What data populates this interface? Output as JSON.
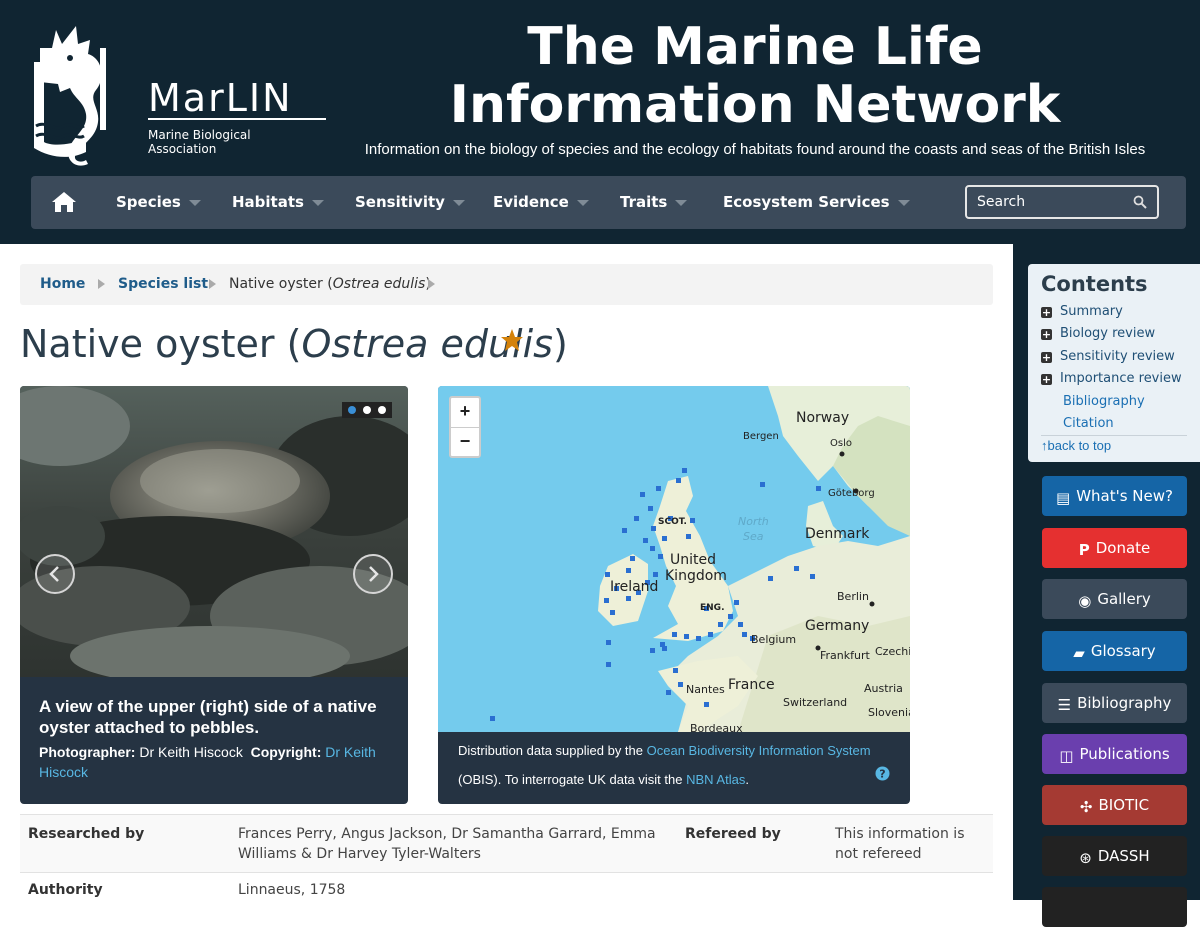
{
  "header": {
    "logo_text": "MarLIN",
    "logo_subtitle": "Marine Biological Association",
    "site_title": "The Marine Life Information Network",
    "tagline": "Information on the biology of species and the ecology of habitats found around the coasts and seas of the British Isles"
  },
  "nav": {
    "home_icon": "home-icon",
    "items": [
      {
        "label": "Species"
      },
      {
        "label": "Habitats"
      },
      {
        "label": "Sensitivity"
      },
      {
        "label": "Evidence"
      },
      {
        "label": "Traits"
      },
      {
        "label": "Ecosystem Services"
      }
    ],
    "search_placeholder": "Search"
  },
  "breadcrumb": {
    "home": "Home",
    "species_list": "Species list",
    "current_common": "Native oyster (",
    "current_sci": "Ostrea edulis",
    "current_end": ")"
  },
  "page": {
    "title_common": "Native oyster (",
    "title_sci": "Ostrea edulis",
    "title_end": ")",
    "favourite_icon": "star-icon"
  },
  "photo": {
    "caption": "A view of the upper (right) side of a native oyster attached to pebbles.",
    "photographer_label": "Photographer:",
    "photographer": "Dr Keith Hiscock",
    "copyright_label": "Copyright:",
    "copyright": "Dr Keith Hiscock",
    "slide_count": 3,
    "active_slide": 1
  },
  "map": {
    "zoom_in": "+",
    "zoom_out": "−",
    "labels": {
      "norway": "Norway",
      "bergen": "Bergen",
      "oslo": "Oslo",
      "goteborg": "Göteborg",
      "north_sea_1": "North",
      "north_sea_2": "Sea",
      "denmark": "Denmark",
      "scot": "SCOT.",
      "united": "United",
      "kingdom": "Kingdom",
      "ireland": "Ireland",
      "eng": "ENG.",
      "berlin": "Berlin",
      "germany": "Germany",
      "belgium": "Belgium",
      "frankfurt": "Frankfurt",
      "czechia": "Czechia",
      "france": "France",
      "nantes": "Nantes",
      "austria": "Austria",
      "switzerland": "Switzerland",
      "slovenia": "Slovenia",
      "bordeaux": "Bordeaux"
    },
    "note_prefix": "Distribution data supplied by the ",
    "note_link1": "Ocean Biodiversity Information System",
    "note_middle": " (OBIS). To interrogate UK data visit the ",
    "note_link2": "NBN Atlas",
    "note_end": ".",
    "help_icon": "help-icon"
  },
  "meta": {
    "researched_label": "Researched by",
    "researched_value": "Frances Perry, Angus Jackson, Dr Samantha Garrard, Emma Williams & Dr Harvey Tyler-Walters",
    "refereed_label": "Refereed by",
    "refereed_value": "This information is not refereed",
    "authority_label": "Authority",
    "authority_value": "Linnaeus, 1758"
  },
  "contents": {
    "title": "Contents",
    "items": [
      {
        "label": "Summary"
      },
      {
        "label": "Biology review"
      },
      {
        "label": "Sensitivity review"
      },
      {
        "label": "Importance review"
      }
    ],
    "links": [
      {
        "label": "Bibliography"
      },
      {
        "label": "Citation"
      }
    ],
    "back_to_top": "back to top"
  },
  "sidebar_buttons": [
    {
      "label": "What's New?",
      "color": "#1565a6",
      "icon": "newspaper-icon"
    },
    {
      "label": "Donate",
      "color": "#e53030",
      "icon": "paypal-icon"
    },
    {
      "label": "Gallery",
      "color": "#3b4a5a",
      "icon": "camera-icon"
    },
    {
      "label": "Glossary",
      "color": "#1565a6",
      "icon": "book-icon"
    },
    {
      "label": "Bibliography",
      "color": "#3b4a5a",
      "icon": "list-icon"
    },
    {
      "label": "Publications",
      "color": "#6a3fae",
      "icon": "open-book-icon"
    },
    {
      "label": "BIOTIC",
      "color": "#a53a33",
      "icon": "biotic-icon"
    },
    {
      "label": "DASSH",
      "color": "#222222",
      "icon": "dassh-icon"
    }
  ]
}
